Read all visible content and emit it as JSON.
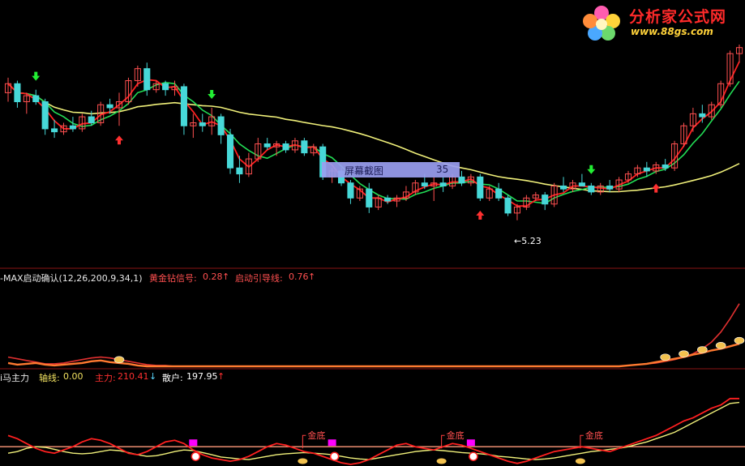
{
  "colors": {
    "background": "#000000",
    "separator": "#8a1414",
    "up_candle": "#ff5050",
    "down_candle": "#47d8d8",
    "ma_red": "#ff2020",
    "ma_green": "#22dd55",
    "ma_yellow": "#f0f07a",
    "signal_up": "#ff3030",
    "signal_down": "#22ee33",
    "magenta": "#ff00ff",
    "gold": "#f2c14e"
  },
  "logo": {
    "title": "分析家公式网",
    "url": "www.88gs.com",
    "icon": "flower-logo-icon"
  },
  "popup": {
    "label": "屏幕截图",
    "value": "35"
  },
  "low_marker": {
    "text": "←5.23"
  },
  "panel1": {
    "name": "-MAX启动确认(12,26,200,9,34,1)",
    "gold_label": "黄金钻信号:",
    "gold_value": "0.28",
    "gold_arrow": "↑",
    "guide_label": "启动引导线:",
    "guide_value": "0.76",
    "guide_arrow": "↑"
  },
  "panel2": {
    "name": "i马主力",
    "axis_label": "轴线:",
    "axis_value": "0.00",
    "main_label": "主力:",
    "main_value": "210.41",
    "main_arrow": "↓",
    "retail_label": "散户:",
    "retail_value": "197.95",
    "retail_arrow": "↑",
    "jindi_label": "金底"
  },
  "chart_data": {
    "type": "candlestick",
    "price_range": [
      4.6,
      7.9
    ],
    "low_annotation": 5.23,
    "candles": [
      [
        7.1,
        7.35,
        6.95,
        7.25
      ],
      [
        7.25,
        7.3,
        6.85,
        6.95
      ],
      [
        6.95,
        7.1,
        6.75,
        7.05
      ],
      [
        7.05,
        7.15,
        6.9,
        6.95
      ],
      [
        6.95,
        7.0,
        6.4,
        6.5
      ],
      [
        6.5,
        6.65,
        6.35,
        6.45
      ],
      [
        6.45,
        6.6,
        6.4,
        6.55
      ],
      [
        6.55,
        6.7,
        6.45,
        6.5
      ],
      [
        6.5,
        6.75,
        6.45,
        6.7
      ],
      [
        6.7,
        6.8,
        6.55,
        6.6
      ],
      [
        6.6,
        6.95,
        6.55,
        6.9
      ],
      [
        6.9,
        7.0,
        6.75,
        6.85
      ],
      [
        6.85,
        7.1,
        6.55,
        6.95
      ],
      [
        6.95,
        7.35,
        6.9,
        7.3
      ],
      [
        7.3,
        7.55,
        7.2,
        7.5
      ],
      [
        7.5,
        7.6,
        7.05,
        7.15
      ],
      [
        7.15,
        7.3,
        7.1,
        7.25
      ],
      [
        7.25,
        7.3,
        7.05,
        7.15
      ],
      [
        7.15,
        7.3,
        7.05,
        7.2
      ],
      [
        7.2,
        7.25,
        6.4,
        6.55
      ],
      [
        6.55,
        6.75,
        6.35,
        6.6
      ],
      [
        6.6,
        6.75,
        6.45,
        6.55
      ],
      [
        6.55,
        6.85,
        6.4,
        6.7
      ],
      [
        6.7,
        6.75,
        6.25,
        6.4
      ],
      [
        6.4,
        6.5,
        5.75,
        5.85
      ],
      [
        5.85,
        6.05,
        5.6,
        5.75
      ],
      [
        5.75,
        6.1,
        5.7,
        6.0
      ],
      [
        6.0,
        6.35,
        5.95,
        6.25
      ],
      [
        6.25,
        6.35,
        6.15,
        6.2
      ],
      [
        6.2,
        6.3,
        6.05,
        6.25
      ],
      [
        6.25,
        6.3,
        6.1,
        6.15
      ],
      [
        6.15,
        6.35,
        6.1,
        6.3
      ],
      [
        6.3,
        6.35,
        6.05,
        6.1
      ],
      [
        6.1,
        6.25,
        6.05,
        6.2
      ],
      [
        6.2,
        6.25,
        5.65,
        5.7
      ],
      [
        5.7,
        5.85,
        5.6,
        5.8
      ],
      [
        5.8,
        5.85,
        5.55,
        5.6
      ],
      [
        5.6,
        5.65,
        5.25,
        5.35
      ],
      [
        5.35,
        5.55,
        5.3,
        5.5
      ],
      [
        5.5,
        5.6,
        5.1,
        5.2
      ],
      [
        5.2,
        5.4,
        5.15,
        5.35
      ],
      [
        5.35,
        5.4,
        5.25,
        5.3
      ],
      [
        5.3,
        5.4,
        5.2,
        5.35
      ],
      [
        5.35,
        5.55,
        5.3,
        5.45
      ],
      [
        5.45,
        5.65,
        5.4,
        5.6
      ],
      [
        5.6,
        5.75,
        5.5,
        5.55
      ],
      [
        5.55,
        5.7,
        5.3,
        5.6
      ],
      [
        5.6,
        5.7,
        5.45,
        5.55
      ],
      [
        5.55,
        5.75,
        5.5,
        5.7
      ],
      [
        5.7,
        5.8,
        5.55,
        5.6
      ],
      [
        5.6,
        5.75,
        5.55,
        5.7
      ],
      [
        5.7,
        5.75,
        5.3,
        5.35
      ],
      [
        5.35,
        5.55,
        5.3,
        5.5
      ],
      [
        5.5,
        5.6,
        5.3,
        5.35
      ],
      [
        5.35,
        5.4,
        5.05,
        5.1
      ],
      [
        5.1,
        5.25,
        4.98,
        5.2
      ],
      [
        5.2,
        5.4,
        5.15,
        5.35
      ],
      [
        5.35,
        5.45,
        5.3,
        5.4
      ],
      [
        5.4,
        5.45,
        5.15,
        5.25
      ],
      [
        5.25,
        5.6,
        5.2,
        5.55
      ],
      [
        5.55,
        5.7,
        5.45,
        5.5
      ],
      [
        5.5,
        5.65,
        5.45,
        5.6
      ],
      [
        5.6,
        5.75,
        5.55,
        5.55
      ],
      [
        5.55,
        5.6,
        5.4,
        5.45
      ],
      [
        5.45,
        5.6,
        5.4,
        5.55
      ],
      [
        5.55,
        5.65,
        5.45,
        5.5
      ],
      [
        5.5,
        5.7,
        5.45,
        5.65
      ],
      [
        5.65,
        5.8,
        5.6,
        5.75
      ],
      [
        5.75,
        5.9,
        5.7,
        5.85
      ],
      [
        5.85,
        5.95,
        5.7,
        5.8
      ],
      [
        5.8,
        5.95,
        5.75,
        5.9
      ],
      [
        5.9,
        6.0,
        5.8,
        5.85
      ],
      [
        5.85,
        6.3,
        5.8,
        6.25
      ],
      [
        6.25,
        6.6,
        6.2,
        6.55
      ],
      [
        6.55,
        6.85,
        6.45,
        6.75
      ],
      [
        6.75,
        6.9,
        6.6,
        6.7
      ],
      [
        6.7,
        6.95,
        6.65,
        6.9
      ],
      [
        6.9,
        7.3,
        6.85,
        7.25
      ],
      [
        7.25,
        7.8,
        7.2,
        7.75
      ],
      [
        7.75,
        7.9,
        7.6,
        7.85
      ]
    ],
    "signals_up": [
      12,
      51,
      70
    ],
    "signals_down": [
      3,
      22,
      63
    ],
    "panel1_range": [
      0,
      1
    ],
    "panel1_gold": [
      0.05,
      0.03,
      0.04,
      0.05,
      0.03,
      0.02,
      0.03,
      0.04,
      0.05,
      0.07,
      0.08,
      0.06,
      0.05,
      0.04,
      0.02,
      0.01,
      0.01,
      0.01,
      0.01,
      0.01,
      0.01,
      0.01,
      0.01,
      0.01,
      0.01,
      0.01,
      0.01,
      0.01,
      0.01,
      0.01,
      0.01,
      0.01,
      0.01,
      0.01,
      0.01,
      0.01,
      0.01,
      0.01,
      0.01,
      0.01,
      0.01,
      0.01,
      0.01,
      0.01,
      0.01,
      0.01,
      0.01,
      0.01,
      0.01,
      0.01,
      0.01,
      0.01,
      0.01,
      0.01,
      0.01,
      0.01,
      0.01,
      0.01,
      0.01,
      0.01,
      0.01,
      0.01,
      0.01,
      0.01,
      0.01,
      0.01,
      0.01,
      0.02,
      0.03,
      0.04,
      0.06,
      0.08,
      0.1,
      0.12,
      0.15,
      0.17,
      0.2,
      0.22,
      0.25,
      0.28
    ],
    "panel1_guide": [
      0.12,
      0.1,
      0.08,
      0.06,
      0.04,
      0.04,
      0.05,
      0.07,
      0.09,
      0.11,
      0.12,
      0.11,
      0.09,
      0.07,
      0.05,
      0.03,
      0.02,
      0.02,
      0.01,
      0.01,
      0.01,
      0.01,
      0.01,
      0.01,
      0.01,
      0.01,
      0.01,
      0.01,
      0.01,
      0.01,
      0.01,
      0.01,
      0.01,
      0.01,
      0.01,
      0.01,
      0.01,
      0.01,
      0.01,
      0.01,
      0.01,
      0.01,
      0.01,
      0.01,
      0.01,
      0.01,
      0.01,
      0.01,
      0.01,
      0.01,
      0.01,
      0.01,
      0.01,
      0.01,
      0.01,
      0.01,
      0.01,
      0.01,
      0.01,
      0.01,
      0.01,
      0.01,
      0.01,
      0.01,
      0.01,
      0.01,
      0.01,
      0.02,
      0.03,
      0.04,
      0.05,
      0.07,
      0.09,
      0.12,
      0.16,
      0.22,
      0.3,
      0.42,
      0.58,
      0.76
    ],
    "panel1_gold_markers": [
      12,
      71,
      73,
      75,
      77,
      79
    ],
    "panel2_range": [
      0,
      260
    ],
    "panel2_axis": 0.0,
    "panel2_main": [
      95,
      85,
      70,
      55,
      45,
      40,
      50,
      60,
      75,
      85,
      80,
      70,
      55,
      40,
      35,
      45,
      60,
      75,
      80,
      70,
      50,
      35,
      25,
      20,
      15,
      20,
      30,
      45,
      60,
      70,
      65,
      55,
      45,
      40,
      30,
      20,
      10,
      5,
      10,
      20,
      35,
      50,
      65,
      70,
      60,
      55,
      50,
      60,
      70,
      65,
      55,
      45,
      35,
      25,
      15,
      8,
      15,
      25,
      35,
      45,
      50,
      55,
      60,
      55,
      50,
      45,
      55,
      65,
      75,
      85,
      95,
      110,
      125,
      140,
      150,
      165,
      180,
      190,
      210,
      210
    ],
    "panel2_retail": [
      40,
      45,
      55,
      60,
      58,
      52,
      45,
      40,
      38,
      40,
      45,
      50,
      48,
      42,
      35,
      30,
      32,
      38,
      45,
      50,
      48,
      42,
      35,
      28,
      25,
      22,
      20,
      25,
      30,
      35,
      38,
      40,
      42,
      40,
      38,
      35,
      30,
      25,
      22,
      20,
      25,
      30,
      35,
      40,
      45,
      48,
      50,
      48,
      45,
      42,
      40,
      38,
      35,
      30,
      28,
      25,
      22,
      20,
      22,
      25,
      30,
      35,
      40,
      45,
      48,
      52,
      55,
      60,
      68,
      75,
      85,
      95,
      105,
      120,
      135,
      150,
      165,
      180,
      195,
      198
    ],
    "panel2_level": 60,
    "panel2_jindi": [
      32,
      47,
      62
    ],
    "panel2_magenta": [
      20,
      35,
      50
    ]
  }
}
